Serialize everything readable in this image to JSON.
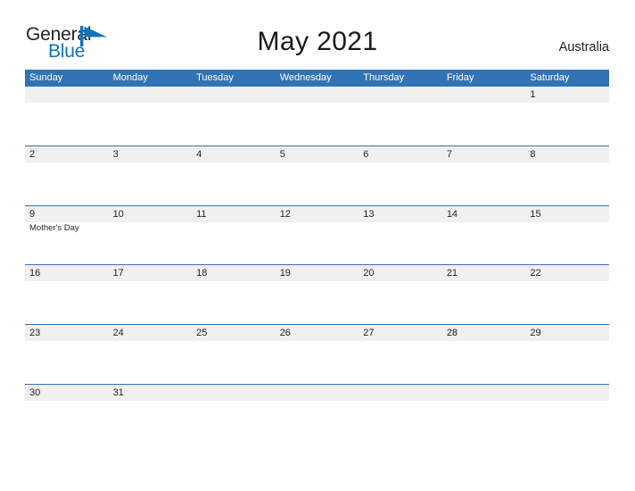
{
  "branding": {
    "logo_text_1": "General",
    "logo_text_2": "Blue",
    "logo_mark": "triangle-flag-icon",
    "logo_mark_color": "#1072ba",
    "logo_text_1_color": "#231f20",
    "logo_text_2_color": "#1072ba"
  },
  "header": {
    "title": "May 2021",
    "month": "May",
    "year": "2021",
    "locale": "Australia"
  },
  "colors": {
    "header_blue": "#3173b4",
    "row_divider_blue": "#2e74b5",
    "band_gray": "#f0f0f0",
    "text": "#231f20",
    "background": "#ffffff"
  },
  "calendar": {
    "day_headers": [
      "Sunday",
      "Monday",
      "Tuesday",
      "Wednesday",
      "Thursday",
      "Friday",
      "Saturday"
    ],
    "weeks": [
      {
        "days": [
          {
            "num": "",
            "event": ""
          },
          {
            "num": "",
            "event": ""
          },
          {
            "num": "",
            "event": ""
          },
          {
            "num": "",
            "event": ""
          },
          {
            "num": "",
            "event": ""
          },
          {
            "num": "",
            "event": ""
          },
          {
            "num": "1",
            "event": ""
          }
        ]
      },
      {
        "days": [
          {
            "num": "2",
            "event": ""
          },
          {
            "num": "3",
            "event": ""
          },
          {
            "num": "4",
            "event": ""
          },
          {
            "num": "5",
            "event": ""
          },
          {
            "num": "6",
            "event": ""
          },
          {
            "num": "7",
            "event": ""
          },
          {
            "num": "8",
            "event": ""
          }
        ]
      },
      {
        "days": [
          {
            "num": "9",
            "event": "Mother's Day"
          },
          {
            "num": "10",
            "event": ""
          },
          {
            "num": "11",
            "event": ""
          },
          {
            "num": "12",
            "event": ""
          },
          {
            "num": "13",
            "event": ""
          },
          {
            "num": "14",
            "event": ""
          },
          {
            "num": "15",
            "event": ""
          }
        ]
      },
      {
        "days": [
          {
            "num": "16",
            "event": ""
          },
          {
            "num": "17",
            "event": ""
          },
          {
            "num": "18",
            "event": ""
          },
          {
            "num": "19",
            "event": ""
          },
          {
            "num": "20",
            "event": ""
          },
          {
            "num": "21",
            "event": ""
          },
          {
            "num": "22",
            "event": ""
          }
        ]
      },
      {
        "days": [
          {
            "num": "23",
            "event": ""
          },
          {
            "num": "24",
            "event": ""
          },
          {
            "num": "25",
            "event": ""
          },
          {
            "num": "26",
            "event": ""
          },
          {
            "num": "27",
            "event": ""
          },
          {
            "num": "28",
            "event": ""
          },
          {
            "num": "29",
            "event": ""
          }
        ]
      },
      {
        "days": [
          {
            "num": "30",
            "event": ""
          },
          {
            "num": "31",
            "event": ""
          },
          {
            "num": "",
            "event": ""
          },
          {
            "num": "",
            "event": ""
          },
          {
            "num": "",
            "event": ""
          },
          {
            "num": "",
            "event": ""
          },
          {
            "num": "",
            "event": ""
          }
        ]
      }
    ]
  }
}
